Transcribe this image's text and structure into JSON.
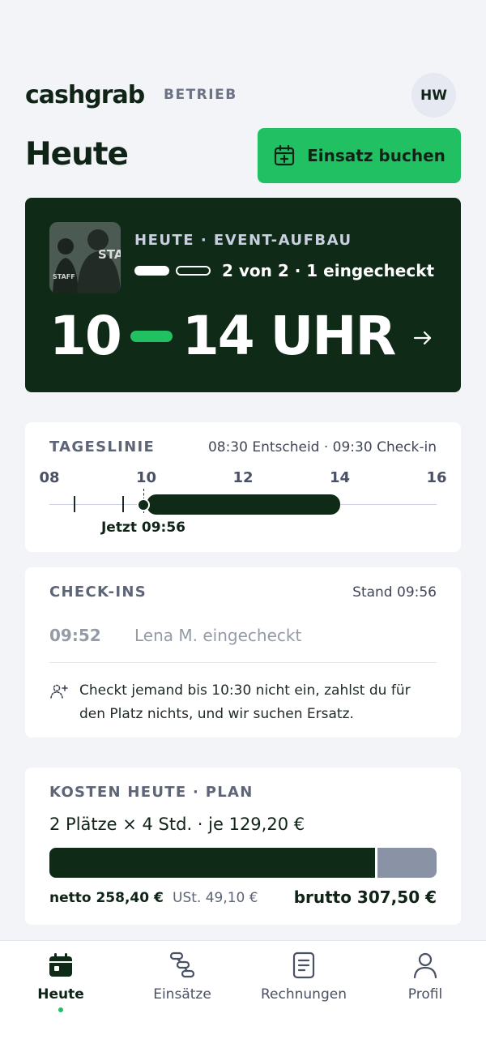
{
  "header": {
    "logo": "cashgrab",
    "logo_sub": "BETRIEB",
    "avatar_initials": "HW"
  },
  "page": {
    "title": "Heute",
    "book_button": "Einsatz buchen"
  },
  "event": {
    "label": "HEUTE · EVENT-AUFBAU",
    "checked_in_slots": 1,
    "total_slots": 2,
    "checkin_status": "2 von 2 · 1 eingecheckt",
    "time_from": "10",
    "time_to": "14 UHR",
    "photo_text": "STAFF"
  },
  "timeline": {
    "title": "TAGESLINIE",
    "meta": "08:30 Entscheid · 09:30 Check-in",
    "ticks": [
      "08",
      "10",
      "12",
      "14",
      "16"
    ],
    "now_label": "Jetzt 09:56"
  },
  "checkins": {
    "title": "CHECK-INS",
    "meta": "Stand 09:56",
    "entries": [
      {
        "time": "09:52",
        "text": "Lena M. eingecheckt"
      }
    ],
    "note": "Checkt jemand bis 10:30 nicht ein, zahlst du für den Platz nichts, und wir suchen Ersatz."
  },
  "costs": {
    "title": "KOSTEN HEUTE · PLAN",
    "line": "2 Plätze × 4 Std. · je 129,20 €",
    "net_label": "netto 258,40 €",
    "tax_label": "USt. 49,10 €",
    "gross_label": "brutto 307,50 €",
    "net_share": 0.84
  },
  "nav": [
    {
      "label": "Heute",
      "icon": "calendar-icon",
      "active": true
    },
    {
      "label": "Einsätze",
      "icon": "route-icon",
      "active": false
    },
    {
      "label": "Rechnungen",
      "icon": "invoice-icon",
      "active": false
    },
    {
      "label": "Profil",
      "icon": "user-icon",
      "active": false
    }
  ],
  "colors": {
    "brand_green": "#20c063",
    "dark_green": "#102a18",
    "background": "#f3f4f8",
    "tax_gray": "#8a93a6"
  }
}
